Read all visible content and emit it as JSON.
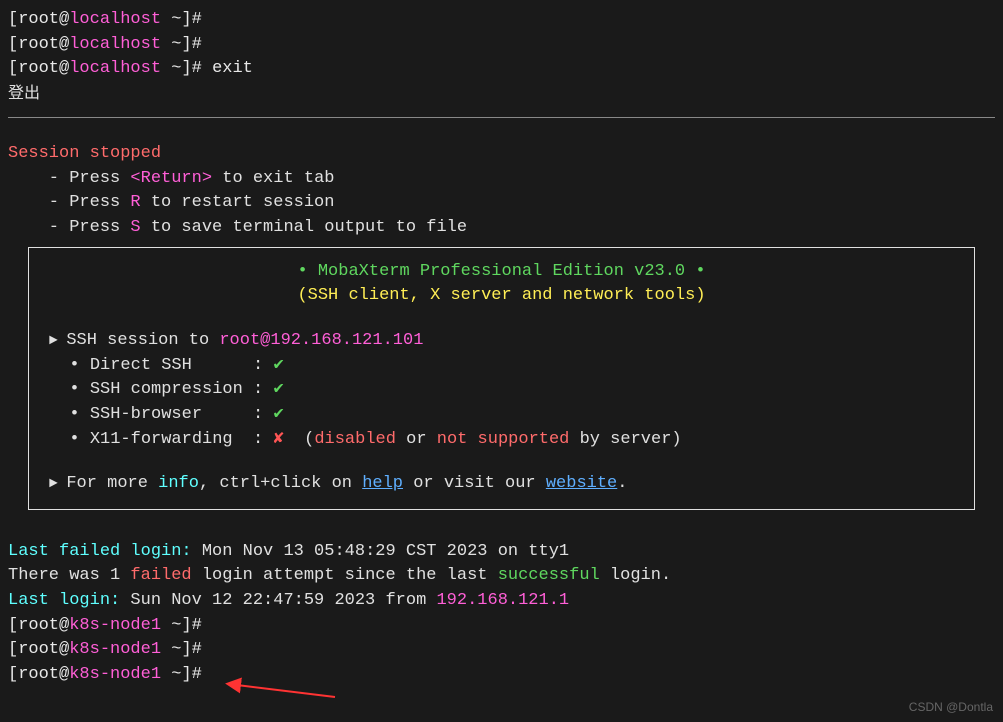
{
  "prompts": {
    "p1": {
      "bracket_open": "[",
      "user": "root",
      "at": "@",
      "host": "localhost",
      "path": " ~",
      "bracket_close": "]#"
    },
    "p2": {
      "bracket_open": "[",
      "user": "root",
      "at": "@",
      "host": "localhost",
      "path": " ~",
      "bracket_close": "]#"
    },
    "p3": {
      "bracket_open": "[",
      "user": "root",
      "at": "@",
      "host": "localhost",
      "path": " ~",
      "bracket_close": "]# ",
      "cmd": "exit"
    }
  },
  "logout_cjk": "登出",
  "session_stopped": "Session stopped",
  "instructions": {
    "ret_pre": "    - Press ",
    "ret_key": "<Return>",
    "ret_post": " to exit tab",
    "r_pre": "    - Press ",
    "r_key": "R",
    "r_post": " to restart session",
    "s_pre": "    - Press ",
    "s_key": "S",
    "s_post": " to save terminal output to file"
  },
  "box": {
    "title_bullet": "• ",
    "title": "MobaXterm Professional Edition v23.0",
    "title_bullet2": " •",
    "subtitle": "(SSH client, X server and network tools)",
    "ssh_session_pre": "SSH session to ",
    "ssh_session_target": "root@192.168.121.101",
    "items": {
      "direct_ssh": {
        "label": "Direct SSH      : ",
        "mark": "✔"
      },
      "ssh_compression": {
        "label": "SSH compression : ",
        "mark": "✔"
      },
      "ssh_browser": {
        "label": "SSH-browser     : ",
        "mark": "✔"
      },
      "x11": {
        "label": "X11-forwarding  : ",
        "mark": "✘",
        "post1": "  (",
        "disabled": "disabled",
        "or": " or ",
        "notsup": "not supported",
        "post2": " by server)"
      }
    },
    "more_pre": "For more ",
    "info": "info",
    "more_mid": ", ctrl+click on ",
    "help": "help",
    "more_mid2": " or visit our ",
    "website": "website",
    "more_end": "."
  },
  "last_failed_label": "Last failed login:",
  "last_failed_value": " Mon Nov 13 05:48:29 CST 2023 on tty1",
  "was_pre": "There was 1 ",
  "was_failed": "failed",
  "was_mid": " login attempt since the last ",
  "was_success": "successful",
  "was_end": " login.",
  "last_login_label": "Last login:",
  "last_login_value": " Sun Nov 12 22:47:59 2023 from ",
  "last_login_ip": "192.168.121.1",
  "prompts_bottom": {
    "b1": {
      "bracket_open": "[",
      "user": "root",
      "at": "@",
      "host": "k8s-node1",
      "path": " ~",
      "bracket_close": "]#"
    },
    "b2": {
      "bracket_open": "[",
      "user": "root",
      "at": "@",
      "host": "k8s-node1",
      "path": " ~",
      "bracket_close": "]#"
    },
    "b3": {
      "bracket_open": "[",
      "user": "root",
      "at": "@",
      "host": "k8s-node1",
      "path": " ~",
      "bracket_close": "]#"
    }
  },
  "watermark": "CSDN @Dontla"
}
